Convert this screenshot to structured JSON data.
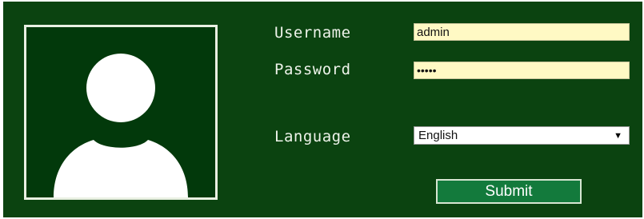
{
  "form": {
    "username_label": "Username",
    "username_value": "admin",
    "password_label": "Password",
    "password_value": "•••••",
    "language_label": "Language",
    "language_selected": "English",
    "submit_label": "Submit"
  },
  "icons": {
    "avatar": "user-silhouette-icon",
    "dropdown": "chevron-down-icon"
  },
  "colors": {
    "panel_background": "#0b4310",
    "avatar_background": "#02390b",
    "input_background": "#fff9c4",
    "button_background": "#137a3c",
    "label_text": "#eef3ea"
  }
}
